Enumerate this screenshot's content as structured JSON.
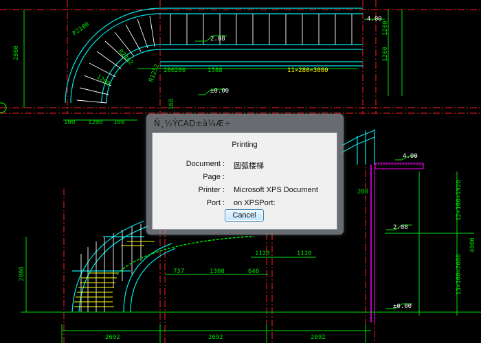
{
  "drawing": {
    "dimensions": [
      "2860",
      "2692",
      "2692",
      "2692",
      "1200",
      "100",
      "100",
      "280",
      "1588",
      "2080",
      "4000",
      "1120",
      "1120",
      "737",
      "1308",
      "646",
      "208",
      "1200",
      "168",
      "4.00",
      "±0.00"
    ],
    "top_labels": [
      "2.08",
      "±0.00",
      "11×280=3080",
      "R2462",
      "R1252",
      "1200",
      "2100",
      "P2100"
    ],
    "right_labels": [
      "4.00",
      "2.08",
      "±0.00",
      "12×160=1920",
      "13×160=2080",
      "4000"
    ],
    "colors": {
      "dim": "#00e000",
      "axis": "#ff2020",
      "stair": "#00e8e8",
      "white": "#ffffff",
      "yellow": "#ffff00",
      "magenta": "#ff00ff"
    }
  },
  "dialog": {
    "title": "Ñ¸½ÝCAD±à¼­Æ÷",
    "heading": "Printing",
    "fields": [
      {
        "label": "Document :",
        "value": "圆弧楼梯"
      },
      {
        "label": "Page :",
        "value": ""
      },
      {
        "label": "Printer :",
        "value": "Microsoft XPS Document"
      },
      {
        "label": "Port :",
        "value": "on XPSPort:"
      }
    ],
    "cancel_label": "Cancel"
  }
}
